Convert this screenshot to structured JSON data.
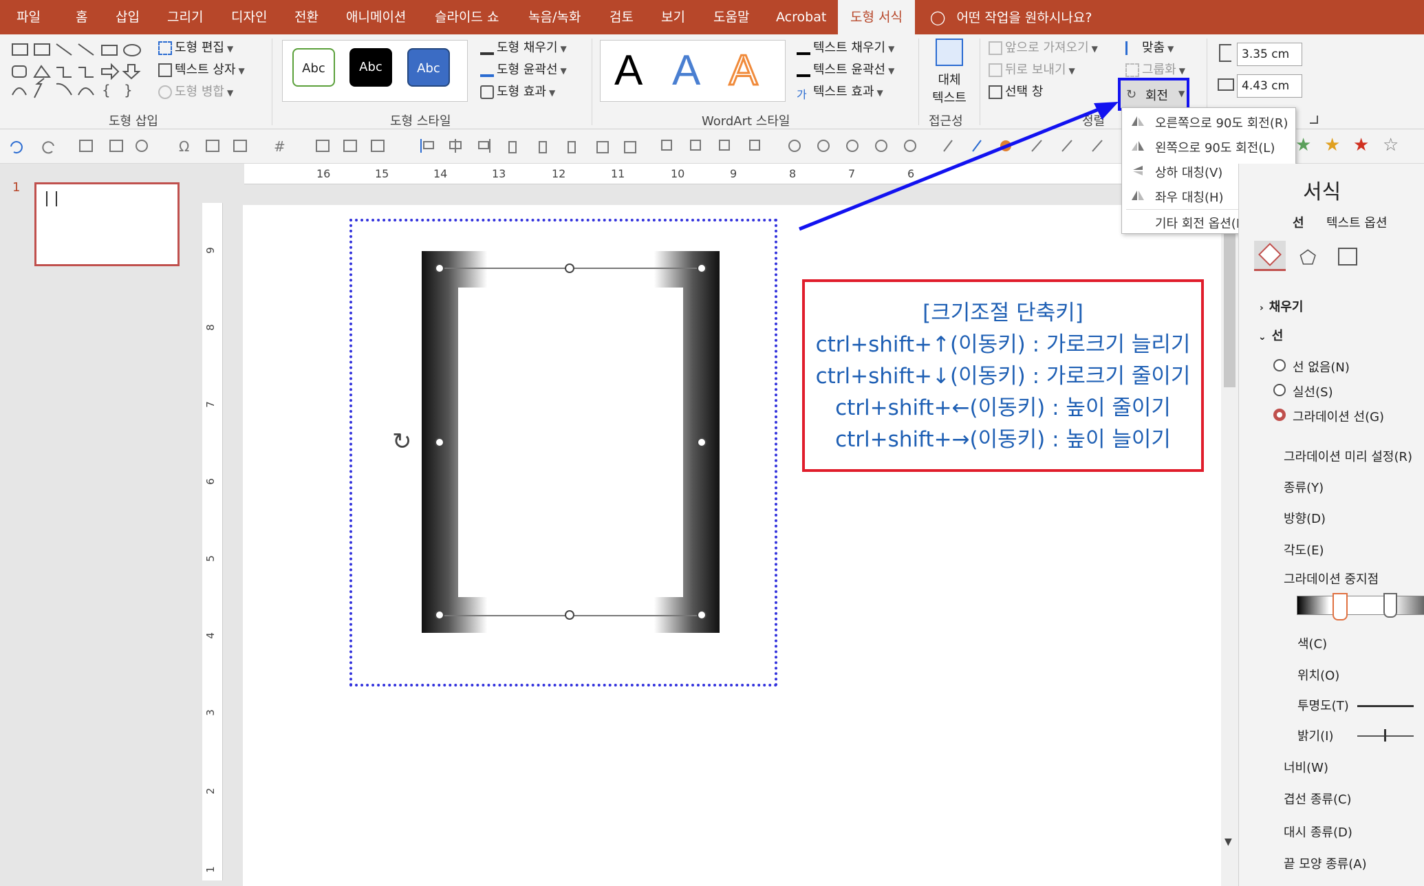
{
  "menu": {
    "tabs": [
      "파일",
      "홈",
      "삽입",
      "그리기",
      "디자인",
      "전환",
      "애니메이션",
      "슬라이드 쇼",
      "녹음/녹화",
      "검토",
      "보기",
      "도움말",
      "Acrobat",
      "도형 서식"
    ],
    "active_tab": "도형 서식",
    "tell_me": "어떤 작업을 원하시나요?"
  },
  "ribbon": {
    "insert_shapes": {
      "edit_shape": "도형 편집",
      "text_box": "텍스트 상자",
      "merge_shapes": "도형 병합",
      "group_label": "도형 삽입"
    },
    "shape_styles": {
      "style_samples": [
        "Abc",
        "Abc",
        "Abc"
      ],
      "fill": "도형 채우기",
      "outline": "도형 윤곽선",
      "effects": "도형 효과",
      "group_label": "도형 스타일"
    },
    "wordart": {
      "letters": [
        "A",
        "A",
        "A"
      ],
      "text_fill": "텍스트 채우기",
      "text_outline": "텍스트 윤곽선",
      "text_effects": "텍스트 효과",
      "group_label": "WordArt 스타일"
    },
    "accessibility": {
      "alt_text_line1": "대체",
      "alt_text_line2": "텍스트",
      "group_label": "접근성"
    },
    "arrange": {
      "bring_forward": "앞으로 가져오기",
      "send_backward": "뒤로 보내기",
      "selection_pane": "선택 창",
      "align": "맞춤",
      "group": "그룹화",
      "rotate": "회전",
      "group_label": "정렬"
    },
    "size": {
      "height": "3.35 cm",
      "width": "4.43 cm"
    }
  },
  "rotate_menu": {
    "items": [
      "오른쪽으로 90도 회전(R)",
      "왼쪽으로 90도 회전(L)",
      "상하 대칭(V)",
      "좌우 대칭(H)",
      "기타 회전 옵션(M)..."
    ]
  },
  "ruler": {
    "horizontal": [
      "16",
      "15",
      "14",
      "13",
      "12",
      "11",
      "10",
      "9",
      "8",
      "7",
      "6"
    ],
    "vertical": [
      "9",
      "8",
      "7",
      "6",
      "5",
      "4",
      "3",
      "2",
      "1"
    ]
  },
  "slides": {
    "number": "1"
  },
  "note": {
    "lines": [
      "[크기조절 단축키]",
      "ctrl+shift+↑(이동키) : 가로크기 늘리기",
      "ctrl+shift+↓(이동키) : 가로크기 줄이기",
      "ctrl+shift+←(이동키) : 높이 줄이기",
      "ctrl+shift+→(이동키) : 높이 늘이기"
    ]
  },
  "format_pane": {
    "title": "서식",
    "tab_shape": "선",
    "tab_text": "텍스트 옵션",
    "fill_header": "채우기",
    "line_header": "선",
    "options": [
      "선 없음(N)",
      "실선(S)",
      "그라데이션 선(G)"
    ],
    "selected_option": "그라데이션 선(G)",
    "props": [
      "그라데이션 미리 설정(R)",
      "종류(Y)",
      "방향(D)",
      "각도(E)",
      "그라데이션 중지점",
      "색(C)",
      "위치(O)",
      "투명도(T)",
      "밝기(I)",
      "너비(W)",
      "겹선 종류(C)",
      "대시 종류(D)",
      "끝 모양 종류(A)"
    ]
  },
  "colors": {
    "accent": "#b7472a",
    "highlight_blue": "#1212f0",
    "note_red": "#e01d2b",
    "note_text": "#1e5fb4"
  }
}
